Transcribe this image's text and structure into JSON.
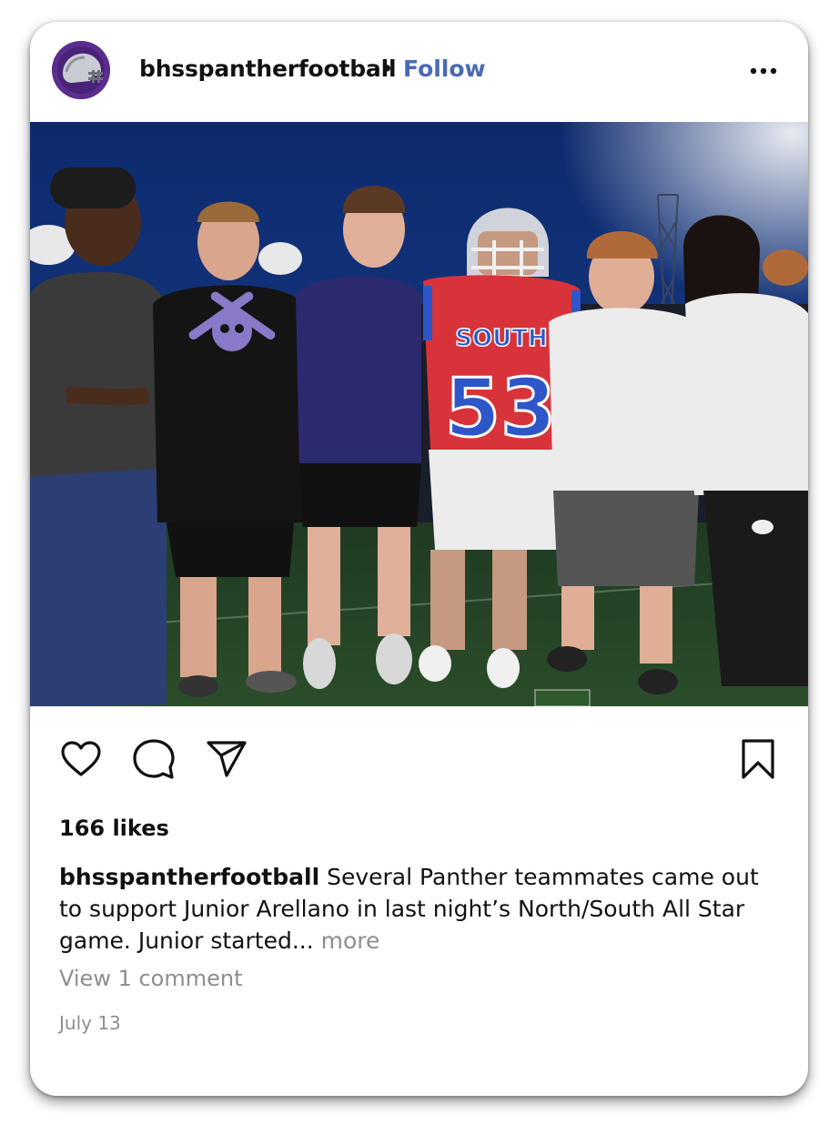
{
  "post": {
    "username": "bhsspantherfootball",
    "separator": "•",
    "follow_label": "Follow",
    "likes": "166 likes",
    "caption_user": "bhsspantherfootball",
    "caption_text": " Several Panther teammates came out to support Junior Arellano in last night’s North/South All Star game. Junior started...",
    "caption_more": " more",
    "view_comments": "View 1 comment",
    "date": "July 13"
  },
  "photo": {
    "jersey_team": "SOUTH",
    "jersey_number": "53"
  },
  "icons": {
    "avatar": "panther-helmet-logo",
    "more": "more-options-icon",
    "like": "heart-icon",
    "comment": "comment-icon",
    "share": "share-icon",
    "save": "bookmark-icon"
  },
  "colors": {
    "follow": "#4a69b5",
    "avatar_bg": "#5b2d8e",
    "jersey_red": "#d8333b",
    "jersey_blue": "#2f56c9"
  }
}
